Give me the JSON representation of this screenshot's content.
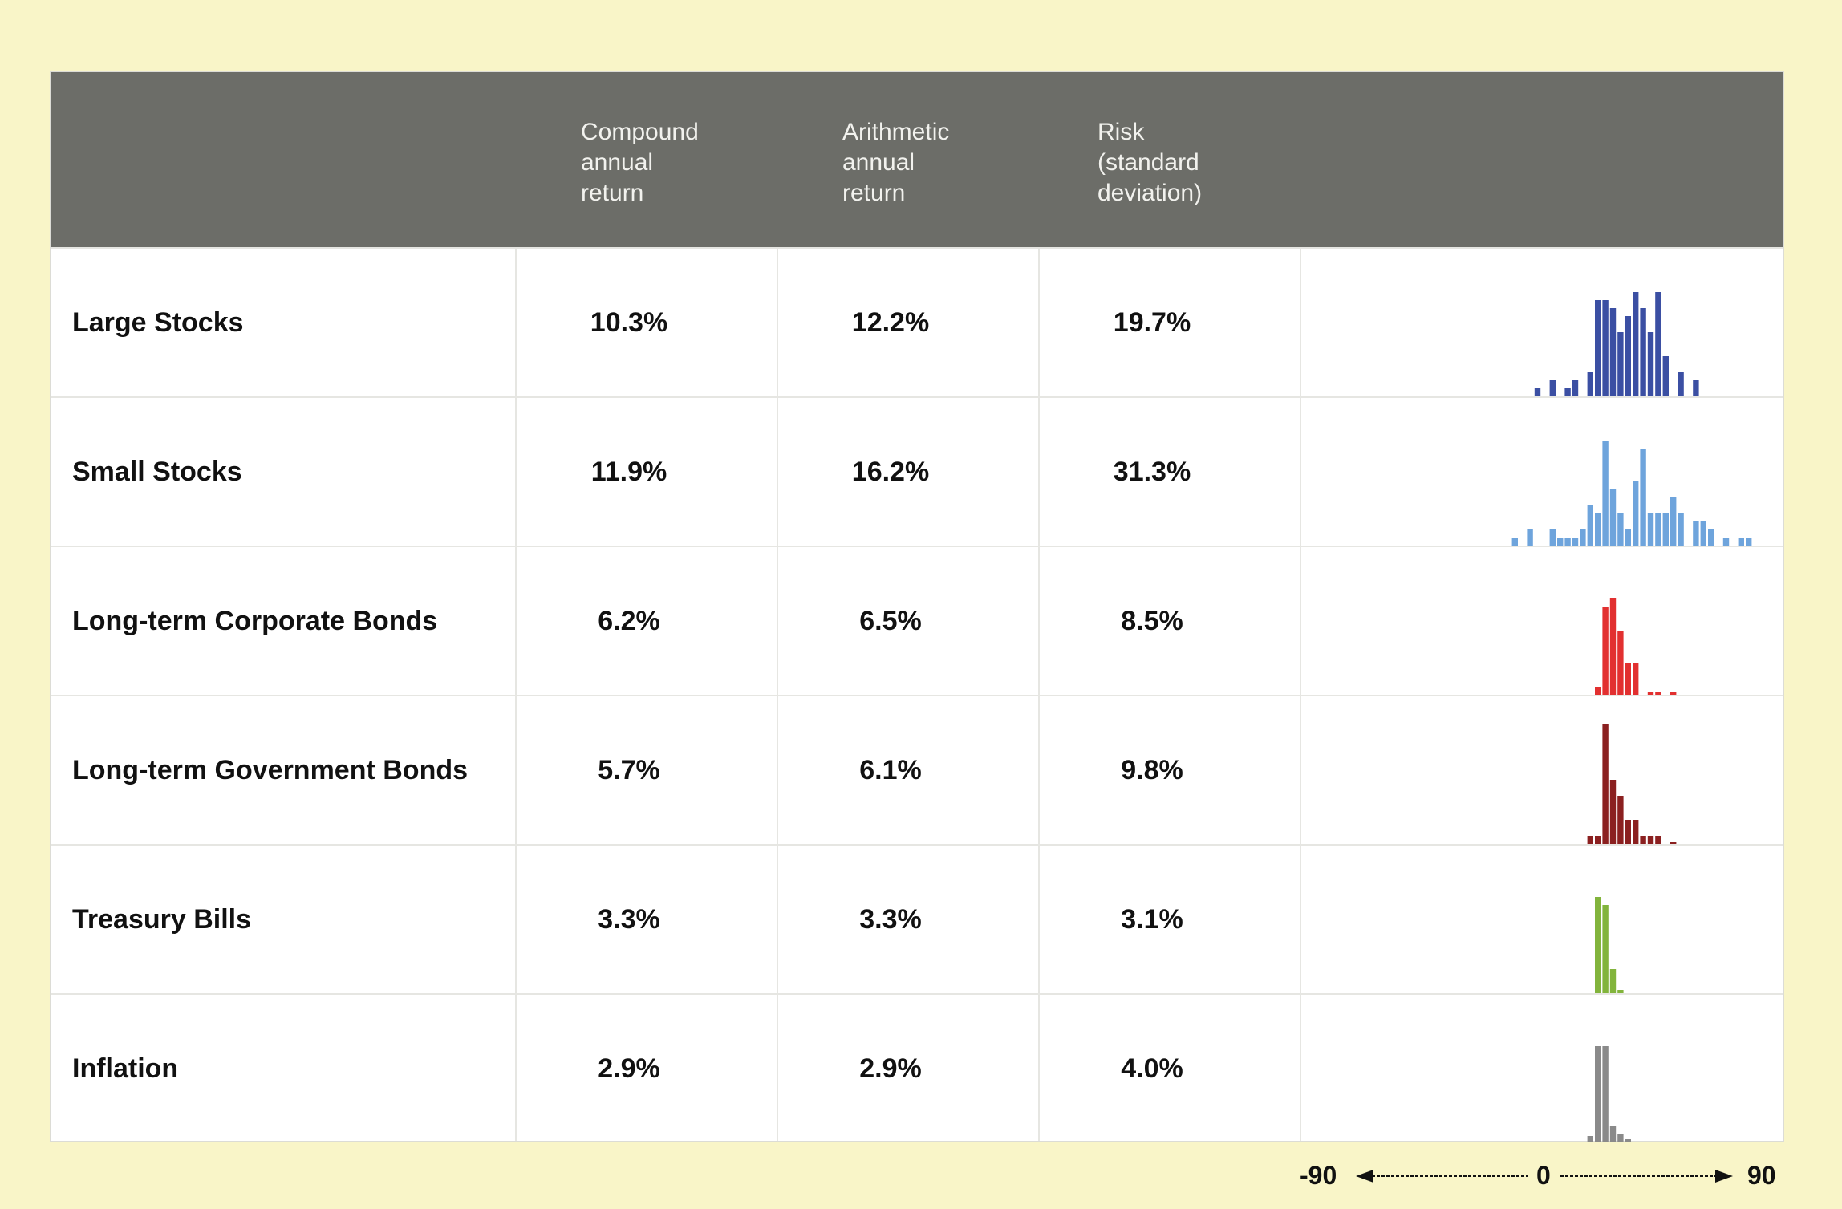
{
  "header": {
    "col1": "Compound\nannual\nreturn",
    "col2": "Arithmetic\nannual\nreturn",
    "col3": "Risk\n(standard\ndeviation)"
  },
  "chart_data": {
    "type": "bar",
    "rows": [
      {
        "label": "Large Stocks",
        "compound": "10.3%",
        "arithmetic": "12.2%",
        "risk": "19.7%",
        "color": "#3b4fa3",
        "distribution": [
          0,
          0,
          0,
          0,
          0,
          0,
          0,
          0,
          0,
          0,
          0,
          0,
          0,
          0,
          0,
          0,
          0,
          1,
          0,
          2,
          0,
          1,
          2,
          0,
          3,
          12,
          12,
          11,
          8,
          10,
          13,
          11,
          8,
          13,
          5,
          0,
          3,
          0,
          2,
          0,
          0,
          0,
          0,
          0,
          0,
          0,
          0,
          0,
          0,
          0
        ]
      },
      {
        "label": "Small Stocks",
        "compound": "11.9%",
        "arithmetic": "16.2%",
        "risk": "31.3%",
        "color": "#6ea4dc",
        "distribution": [
          0,
          0,
          0,
          0,
          0,
          0,
          0,
          0,
          0,
          0,
          0,
          0,
          0,
          0,
          1,
          0,
          2,
          0,
          0,
          2,
          1,
          1,
          1,
          2,
          5,
          4,
          13,
          7,
          4,
          2,
          8,
          12,
          4,
          4,
          4,
          6,
          4,
          0,
          3,
          3,
          2,
          0,
          1,
          0,
          1,
          1,
          0,
          0,
          0,
          0
        ]
      },
      {
        "label": "Long-term Corporate Bonds",
        "compound": "6.2%",
        "arithmetic": "6.5%",
        "risk": "8.5%",
        "color": "#e23030",
        "distribution": [
          0,
          0,
          0,
          0,
          0,
          0,
          0,
          0,
          0,
          0,
          0,
          0,
          0,
          0,
          0,
          0,
          0,
          0,
          0,
          0,
          0,
          0,
          0,
          0,
          0,
          1,
          11,
          12,
          8,
          4,
          4,
          0,
          0.3,
          0.3,
          0,
          0.3,
          0,
          0,
          0,
          0,
          0,
          0,
          0,
          0,
          0,
          0,
          0,
          0,
          0,
          0
        ]
      },
      {
        "label": "Long-term Government Bonds",
        "compound": "5.7%",
        "arithmetic": "6.1%",
        "risk": "9.8%",
        "color": "#8b2020",
        "distribution": [
          0,
          0,
          0,
          0,
          0,
          0,
          0,
          0,
          0,
          0,
          0,
          0,
          0,
          0,
          0,
          0,
          0,
          0,
          0,
          0,
          0,
          0,
          0,
          0,
          1,
          1,
          15,
          8,
          6,
          3,
          3,
          1,
          1,
          1,
          0,
          0.3,
          0,
          0,
          0,
          0,
          0,
          0,
          0,
          0,
          0,
          0,
          0,
          0,
          0,
          0
        ]
      },
      {
        "label": "Treasury Bills",
        "compound": "3.3%",
        "arithmetic": "3.3%",
        "risk": "3.1%",
        "color": "#82b43c",
        "distribution": [
          0,
          0,
          0,
          0,
          0,
          0,
          0,
          0,
          0,
          0,
          0,
          0,
          0,
          0,
          0,
          0,
          0,
          0,
          0,
          0,
          0,
          0,
          0,
          0,
          0,
          0,
          0,
          0,
          0,
          0,
          0,
          0,
          0,
          0,
          0,
          0,
          0,
          0,
          0,
          0,
          0,
          0,
          0,
          0,
          0,
          0,
          0,
          0,
          0,
          0,
          0,
          0,
          0,
          0,
          0,
          0,
          0,
          0,
          0,
          0,
          0,
          0,
          0,
          0,
          0,
          0,
          0,
          0,
          0,
          0,
          0,
          0,
          0,
          0,
          0,
          0,
          0,
          0,
          0,
          0,
          0,
          0,
          0,
          0,
          0,
          0,
          0,
          0,
          0,
          0,
          0,
          0,
          0,
          0,
          0,
          0,
          0,
          0,
          0,
          0
        ]
      },
      {
        "label": "Inflation",
        "compound": "2.9%",
        "arithmetic": "2.9%",
        "risk": "4.0%",
        "color": "#8a8a8a",
        "distribution": []
      }
    ],
    "xlim": [
      -90,
      90
    ],
    "axis": {
      "left": "-90",
      "mid": "0",
      "right": "90"
    }
  }
}
